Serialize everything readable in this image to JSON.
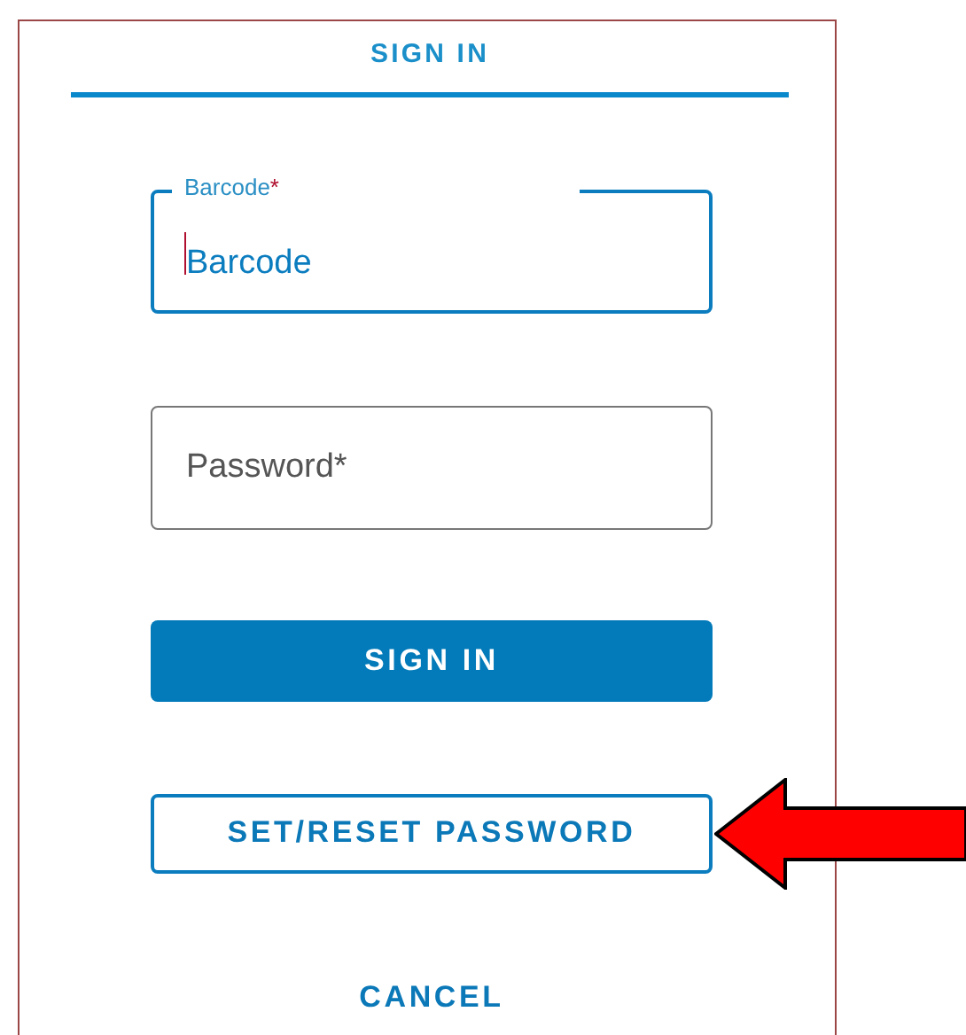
{
  "tabs": [
    {
      "label": "SIGN IN",
      "selected": true
    }
  ],
  "fields": [
    {
      "label": "Barcode",
      "required_mark": "*",
      "value": "Barcode",
      "focused": true
    },
    {
      "placeholder": "Password*",
      "focused": false
    }
  ],
  "buttons": [
    {
      "label": "SIGN IN",
      "kind": "primary"
    },
    {
      "label": "SET/RESET PASSWORD",
      "kind": "outline"
    },
    {
      "label": "CANCEL",
      "kind": "text"
    }
  ]
}
